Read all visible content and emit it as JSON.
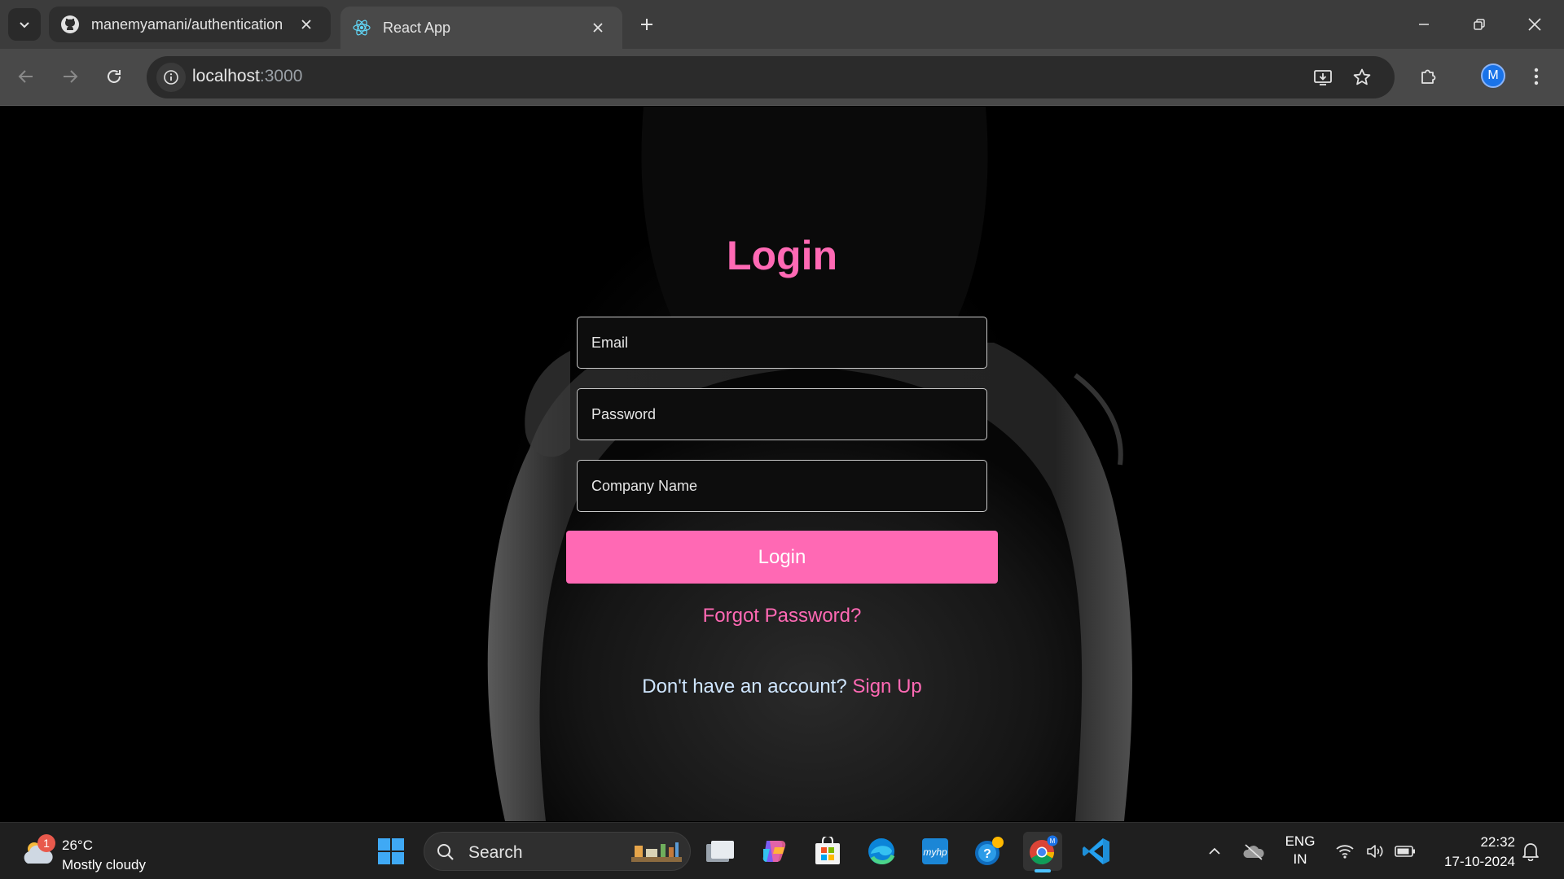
{
  "browser": {
    "tabs": [
      {
        "title": "manemyamani/authentication",
        "icon": "github-icon",
        "active": false
      },
      {
        "title": "React App",
        "icon": "react-icon",
        "active": true
      }
    ],
    "address": {
      "host": "localhost",
      "port": ":3000"
    },
    "profile_initial": "M"
  },
  "page": {
    "title": "Login",
    "fields": {
      "email_placeholder": "Email",
      "password_placeholder": "Password",
      "company_placeholder": "Company Name"
    },
    "login_button": "Login",
    "forgot_link": "Forgot Password?",
    "signup_prompt": "Don't have an account?",
    "signup_link": "Sign Up",
    "colors": {
      "accent": "#ff69b4",
      "background": "#000000"
    }
  },
  "taskbar": {
    "weather": {
      "temp": "26°C",
      "condition": "Mostly cloudy",
      "badge": "1"
    },
    "search_label": "Search",
    "apps": [
      "file-explorer-icon",
      "copilot-icon",
      "microsoft-store-icon",
      "edge-icon",
      "myhp-icon",
      "get-help-icon",
      "chrome-icon",
      "vscode-icon"
    ],
    "lang": {
      "line1": "ENG",
      "line2": "IN"
    },
    "clock": {
      "time": "22:32",
      "date": "17-10-2024"
    }
  }
}
